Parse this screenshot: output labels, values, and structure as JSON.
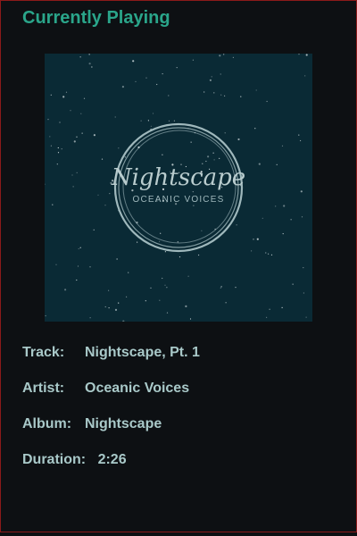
{
  "header": {
    "title": "Currently Playing"
  },
  "cover": {
    "title_script": "Nightscape",
    "subtitle": "OCEANIC VOICES",
    "background": "#0a2a35",
    "ring_color": "#9fb8bc"
  },
  "info": {
    "track": {
      "label": "Track:",
      "value": "Nightscape, Pt. 1"
    },
    "artist": {
      "label": "Artist:",
      "value": "Oceanic Voices"
    },
    "album": {
      "label": "Album:",
      "value": "Nightscape"
    },
    "duration": {
      "label": "Duration:",
      "value": "2:26"
    }
  },
  "colors": {
    "accent": "#2aa58a",
    "text": "#a9c9c9",
    "background": "#0d1013",
    "border": "#8b1a1a"
  }
}
